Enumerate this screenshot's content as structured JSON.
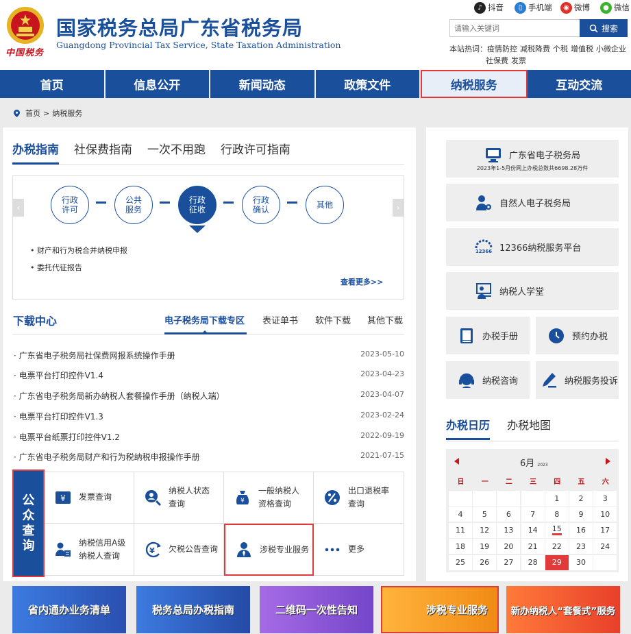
{
  "header": {
    "title": "国家税务总局广东省税务局",
    "subtitle": "Guangdong Provincial Tax Service, State Taxation Administration",
    "logo_text": "中国税务",
    "social": [
      {
        "label": "抖音",
        "icon": "tiktok-icon",
        "color": "#222222"
      },
      {
        "label": "手机端",
        "icon": "mobile-icon",
        "color": "#2a7fd4"
      },
      {
        "label": "微博",
        "icon": "weibo-icon",
        "color": "#e0302a"
      },
      {
        "label": "微信",
        "icon": "wechat-icon",
        "color": "#3bb22e"
      }
    ],
    "search": {
      "placeholder": "请输入关键词",
      "button": "搜索"
    },
    "hot_label": "本站热词：",
    "hot_words_line1": [
      "疫情防控",
      "减税降费",
      "个税",
      "增值税",
      "小微企业"
    ],
    "hot_words_line2": [
      "社保费",
      "发票"
    ]
  },
  "nav": {
    "items": [
      "首页",
      "信息公开",
      "新闻动态",
      "政策文件",
      "纳税服务",
      "互动交流"
    ],
    "active": "纳税服务"
  },
  "breadcrumb": {
    "home": "首页",
    "sep": ">",
    "current": "纳税服务"
  },
  "guide": {
    "tabs": [
      "办税指南",
      "社保费指南",
      "一次不用跑",
      "行政许可指南"
    ],
    "active_tab": "办税指南",
    "steps": [
      {
        "l1": "行政",
        "l2": "许可"
      },
      {
        "l1": "公共",
        "l2": "服务"
      },
      {
        "l1": "行政",
        "l2": "征收"
      },
      {
        "l1": "行政",
        "l2": "确认"
      },
      {
        "l1": "其他",
        "l2": ""
      }
    ],
    "active_step": 2,
    "items": [
      "财产和行为税合并纳税申报",
      "委托代征报告"
    ],
    "more": "查看更多>>"
  },
  "download": {
    "title": "下载中心",
    "tabs": [
      "电子税务局下载专区",
      "表证单书",
      "软件下载",
      "其他下载"
    ],
    "rows": [
      {
        "title": "广东省电子税务局社保费网报系统操作手册",
        "date": "2023-05-10"
      },
      {
        "title": "电票平台打印控件V1.4",
        "date": "2023-04-23"
      },
      {
        "title": "广东省电子税务局新办纳税人套餐操作手册（纳税人端）",
        "date": "2023-04-07"
      },
      {
        "title": "电票平台打印控件V1.3",
        "date": "2023-02-24"
      },
      {
        "title": "电票平台纸票打印控件V1.2",
        "date": "2022-09-19"
      },
      {
        "title": "广东省电子税务局财产和行为税纳税申报操作手册",
        "date": "2021-07-15"
      }
    ]
  },
  "query": {
    "label": [
      "公",
      "众",
      "查",
      "询"
    ],
    "cells": [
      {
        "l1": "发票查询",
        "l2": "",
        "icon": "invoice-icon"
      },
      {
        "l1": "纳税人状态",
        "l2": "查询",
        "icon": "taxpayer-status-icon"
      },
      {
        "l1": "一般纳税人",
        "l2": "资格查询",
        "icon": "general-taxpayer-icon"
      },
      {
        "l1": "出口退税率",
        "l2": "查询",
        "icon": "export-rebate-icon"
      },
      {
        "l1": "纳税信用A级",
        "l2": "纳税人查询",
        "icon": "credit-icon"
      },
      {
        "l1": "欠税公告查询",
        "l2": "",
        "icon": "arrears-icon"
      },
      {
        "l1": "涉税专业服务",
        "l2": "",
        "icon": "professional-service-icon"
      },
      {
        "l1": "更多",
        "l2": "",
        "icon": "more-icon"
      }
    ]
  },
  "right": {
    "etax": {
      "title": "广东省电子税务局",
      "note": "2023年1-5月份网上办税总数共6698.28万件"
    },
    "services": [
      {
        "label": "自然人电子税务局",
        "icon": "natural-person-icon"
      },
      {
        "label": "12366纳税服务平台",
        "icon": "hotline-12366-icon"
      },
      {
        "label": "纳税人学堂",
        "icon": "classroom-icon"
      }
    ],
    "small": [
      {
        "label": "办税手册",
        "icon": "manual-icon"
      },
      {
        "label": "预约办税",
        "icon": "appointment-icon"
      },
      {
        "label": "纳税咨询",
        "icon": "consult-icon"
      },
      {
        "label": "纳税服务投诉",
        "icon": "complaint-icon"
      }
    ],
    "tabs": [
      "办税日历",
      "办税地图"
    ]
  },
  "calendar": {
    "month": "6月",
    "year": "2023",
    "weekdays": [
      "日",
      "一",
      "二",
      "三",
      "四",
      "五",
      "六"
    ],
    "days": [
      "",
      "",
      "",
      "",
      "1",
      "2",
      "3",
      "4",
      "5",
      "6",
      "7",
      "8",
      "9",
      "10",
      "11",
      "12",
      "13",
      "14",
      "15",
      "16",
      "17",
      "18",
      "19",
      "20",
      "21",
      "22",
      "23",
      "24",
      "25",
      "26",
      "27",
      "28",
      "29",
      "30",
      ""
    ],
    "today": "29",
    "marked": "15"
  },
  "banners": [
    {
      "label": "省内通办业务清单",
      "color": "#2f5fc7"
    },
    {
      "label": "税务总局办税指南",
      "color": "#2a5cc0"
    },
    {
      "label": "二维码一次性告知",
      "color": "#8f5ad9"
    },
    {
      "label": "涉税专业服务",
      "color": "#f29a1f"
    },
    {
      "label": "新办纳税人“套餐式”服务",
      "color": "#f0512a"
    }
  ]
}
